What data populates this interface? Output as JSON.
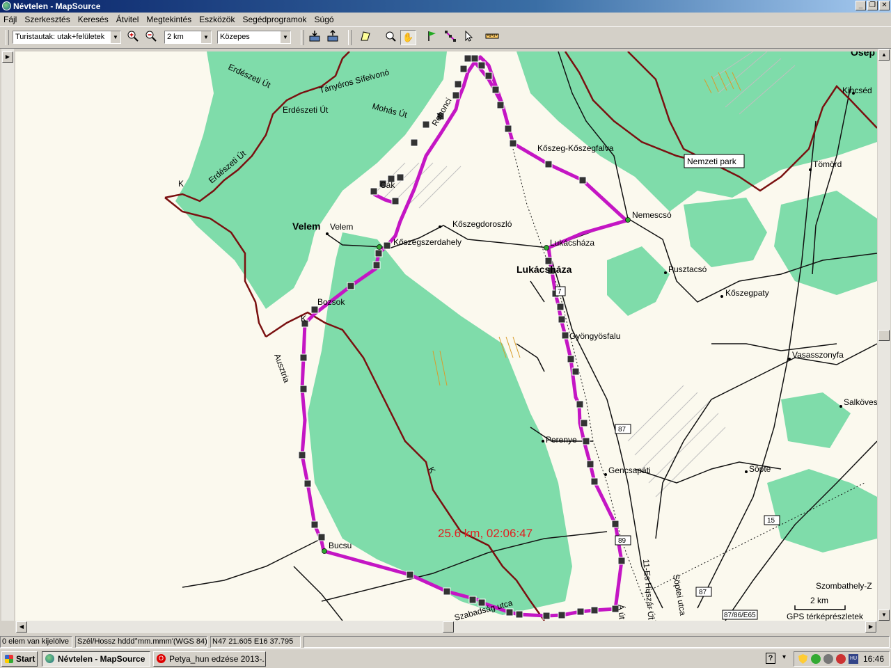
{
  "window": {
    "title": "Névtelen - MapSource"
  },
  "menu": [
    "Fájl",
    "Szerkesztés",
    "Keresés",
    "Átvitel",
    "Megtekintés",
    "Eszközök",
    "Segédprogramok",
    "Súgó"
  ],
  "toolbar": {
    "map_product": "Turistautak: utak+felületek",
    "zoom_level": "2 km",
    "detail_level": "Közepes"
  },
  "map": {
    "towns_major": [
      {
        "name": "Velem",
        "type": "town"
      },
      {
        "name": "Lukácsháza",
        "type": "town"
      }
    ],
    "places": [
      "Velem",
      "Kőszegdoroszló",
      "Kőszegszerdahely",
      "Lukácsháza",
      "Nemescsó",
      "Pusztacsó",
      "Kőszegpaty",
      "Bozsok",
      "Gyöngyösfalu",
      "Vasasszonyfa",
      "Salköves",
      "Perenye",
      "Gencsapáti",
      "Söpte",
      "Bucsu",
      "Kőszeg-Kőszegfalva",
      "Tömörd",
      "Kincséd",
      "Ósep",
      "Cák",
      "Szombathely-Z"
    ],
    "roads": [
      "Erdészeti Út",
      "Tányéros Sífelvonó",
      "Erdészeti Út",
      "Mohás Út",
      "Rohonci",
      "Erdészeti Út",
      "Ausztria",
      "Szabadság utca",
      "11-Es Huszár Út",
      "Söptei utca",
      "Á út"
    ],
    "route_numbers": [
      "87",
      "89",
      "15",
      "87",
      "87/86/E65",
      "7"
    ],
    "trail_marks": [
      "K",
      "K",
      "K"
    ],
    "park_label": "Nemzeti park",
    "track_summary": "25.6 km, 02:06:47",
    "scale_label": "2 km",
    "gps_detail": "GPS térképrészletek",
    "track_color": "#c416c4",
    "forest_color": "#7fdcaa",
    "border_color": "#7a1010"
  },
  "status": {
    "selection": "0 elem van kijelölve",
    "coord_format": "Szél/Hossz hddd°mm.mmm'(WGS 84)",
    "position": "N47 21.605 E16 37.795"
  },
  "taskbar": {
    "start": "Start",
    "task1": "Névtelen - MapSource",
    "task2": "Petya_hun edzése 2013-...",
    "clock": "16:46"
  }
}
